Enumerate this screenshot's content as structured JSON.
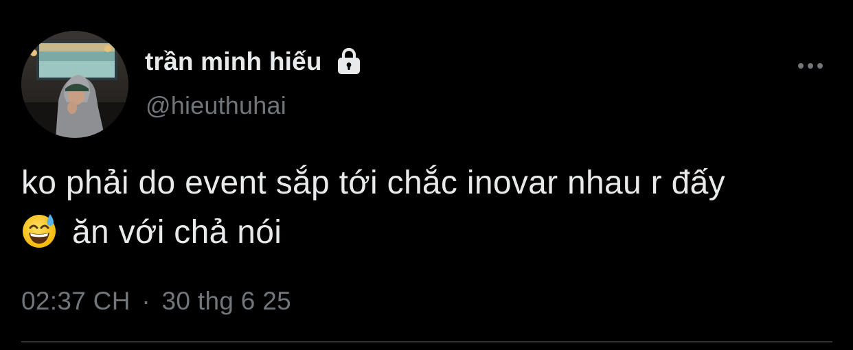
{
  "tweet": {
    "author": {
      "display_name": "trần minh hiếu",
      "handle": "@hieuthuhai",
      "verified_icon": "lock-icon",
      "avatar": "profile-photo"
    },
    "text_line_1": "ko phải do event sắp tới chắc inovar nhau r đấy",
    "text_line_2_emoji": "sweat-smile-emoji-icon",
    "text_line_2": "ăn với chả nói",
    "time": "02:37 CH",
    "separator": "·",
    "date": "30 thg 6 25",
    "more_icon": "more-horizontal-icon"
  },
  "colors": {
    "background": "#000000",
    "primary_text": "#e7e9ea",
    "secondary_text": "#71767b",
    "divider": "#2f3336"
  }
}
